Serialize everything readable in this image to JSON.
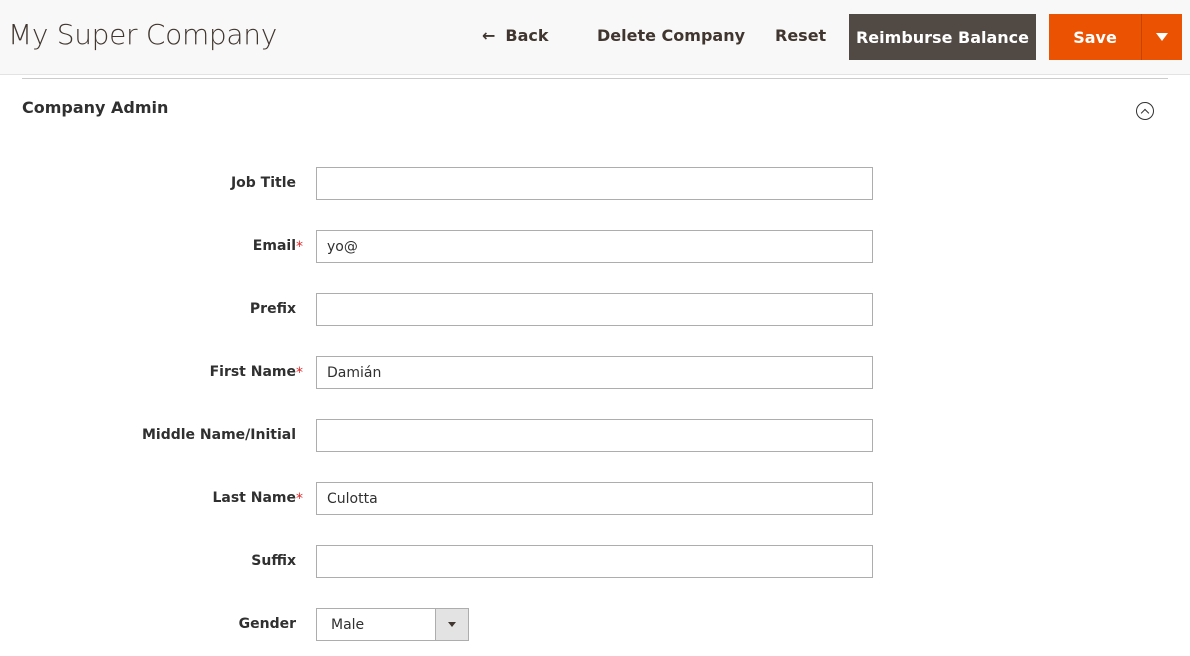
{
  "header": {
    "title": "My Super Company",
    "back_label": "Back",
    "delete_label": "Delete Company",
    "reset_label": "Reset",
    "reimburse_label": "Reimburse Balance",
    "save_label": "Save",
    "back_icon": "←"
  },
  "colors": {
    "save": "#eb5202",
    "reimburse": "#514943",
    "required": "#e22626"
  },
  "section": {
    "title": "Company Admin"
  },
  "fields": [
    {
      "label": "Job Title",
      "value": "",
      "required": false
    },
    {
      "label": "Email",
      "value": "yo@",
      "required": true
    },
    {
      "label": "Prefix",
      "value": "",
      "required": false
    },
    {
      "label": "First Name",
      "value": "Damián",
      "required": true
    },
    {
      "label": "Middle Name/Initial",
      "value": "",
      "required": false
    },
    {
      "label": "Last Name",
      "value": "Culotta",
      "required": true
    },
    {
      "label": "Suffix",
      "value": "",
      "required": false
    }
  ],
  "gender": {
    "label": "Gender",
    "value": "Male"
  },
  "required_mark": "*"
}
